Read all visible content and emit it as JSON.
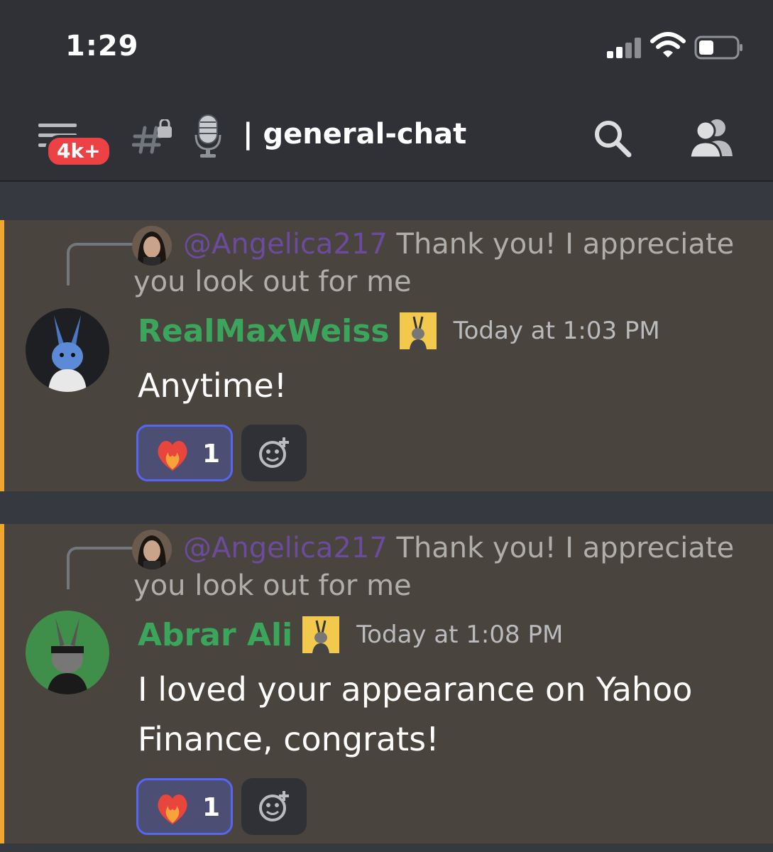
{
  "status_bar": {
    "time": "1:29"
  },
  "header": {
    "badge": "4k+",
    "channel_name": "| general-chat"
  },
  "messages": [
    {
      "reply": {
        "mention": "@Angelica217",
        "text": " Thank you! I appreciate you look out for me"
      },
      "author": "RealMaxWeiss",
      "timestamp": "Today at 1:03 PM",
      "content": "Anytime!",
      "reaction": {
        "count": "1",
        "emoji": "heart-on-fire"
      }
    },
    {
      "reply": {
        "mention": "@Angelica217",
        "text": " Thank you! I appreciate you look out for me"
      },
      "author": "Abrar Ali",
      "timestamp": "Today at 1:08 PM",
      "content": "I loved your appearance on Yahoo Finance, congrats!",
      "reaction": {
        "count": "1",
        "emoji": "heart-on-fire"
      }
    }
  ],
  "colors": {
    "accent": "#5865f2",
    "author": "#3ba55c",
    "mention": "#6c4b9e",
    "highlight_bar": "#f0a732",
    "badge": "#ed4245"
  }
}
